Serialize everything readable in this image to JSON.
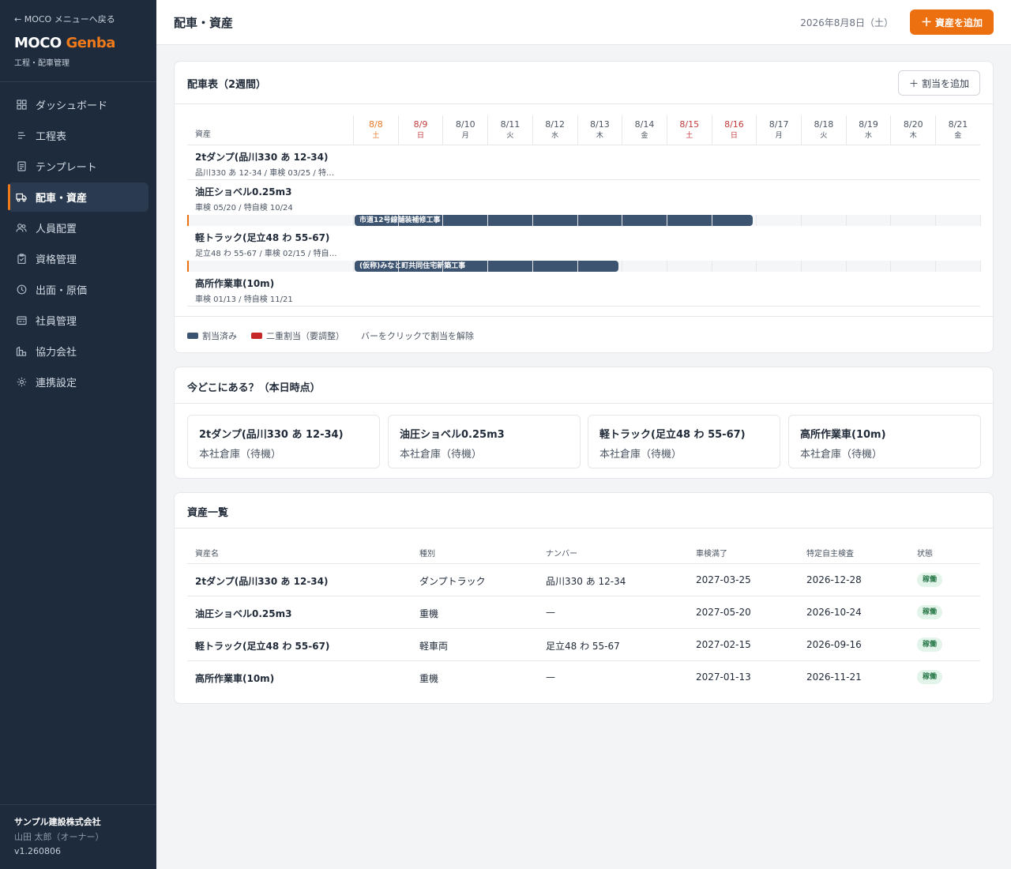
{
  "sidebar": {
    "back_link": "← MOCO メニューへ戻る",
    "brand_main": "MOCO",
    "brand_accent": "Genba",
    "brand_sub": "工程・配車管理",
    "items": [
      {
        "label": "ダッシュボード",
        "icon": "grid-icon"
      },
      {
        "label": "工程表",
        "icon": "list-icon"
      },
      {
        "label": "テンプレート",
        "icon": "document-icon"
      },
      {
        "label": "配車・資産",
        "icon": "truck-icon",
        "active": true
      },
      {
        "label": "人員配置",
        "icon": "users-icon"
      },
      {
        "label": "資格管理",
        "icon": "clipboard-icon"
      },
      {
        "label": "出面・原価",
        "icon": "clock-icon"
      },
      {
        "label": "社員管理",
        "icon": "id-card-icon"
      },
      {
        "label": "協力会社",
        "icon": "building-icon"
      },
      {
        "label": "連携設定",
        "icon": "sun-gear-icon"
      }
    ],
    "company": "サンプル建設株式会社",
    "user": "山田 太郎（オーナー）",
    "version": "v1.260806"
  },
  "header": {
    "title": "配車・資産",
    "date": "2026年8月8日（土）",
    "add_asset_label": "資産を追加"
  },
  "schedule": {
    "title": "配車表（2週間）",
    "add_assignment_label": "割当を追加",
    "asset_header": "資産",
    "days": [
      {
        "date": "8/8",
        "weekday": "土",
        "kind": "sat"
      },
      {
        "date": "8/9",
        "weekday": "日",
        "kind": "hol"
      },
      {
        "date": "8/10",
        "weekday": "月",
        "kind": ""
      },
      {
        "date": "8/11",
        "weekday": "火",
        "kind": ""
      },
      {
        "date": "8/12",
        "weekday": "水",
        "kind": ""
      },
      {
        "date": "8/13",
        "weekday": "木",
        "kind": ""
      },
      {
        "date": "8/14",
        "weekday": "金",
        "kind": ""
      },
      {
        "date": "8/15",
        "weekday": "土",
        "kind": "hol"
      },
      {
        "date": "8/16",
        "weekday": "日",
        "kind": "hol"
      },
      {
        "date": "8/17",
        "weekday": "月",
        "kind": ""
      },
      {
        "date": "8/18",
        "weekday": "火",
        "kind": ""
      },
      {
        "date": "8/19",
        "weekday": "水",
        "kind": ""
      },
      {
        "date": "8/20",
        "weekday": "木",
        "kind": ""
      },
      {
        "date": "8/21",
        "weekday": "金",
        "kind": ""
      }
    ],
    "rows": [
      {
        "name": "2tダンプ(品川330 あ 12-34)",
        "sub": "品川330 あ 12-34 / 車検 03/25 / 特…"
      },
      {
        "name": "油圧ショベル0.25m3",
        "sub": "車検 05/20 / 特自検 10/24"
      },
      {
        "name": "軽トラック(足立48 わ 55-67)",
        "sub": "足立48 わ 55-67 / 車検 02/15 / 特自…"
      },
      {
        "name": "高所作業車(10m)",
        "sub": "車検 01/13 / 特自検 11/21"
      }
    ],
    "assignments": [
      {
        "label": "市道12号線舗装補修工事",
        "start_day": 0,
        "span_days": 9
      },
      {
        "label": "(仮称)みなと町共同住宅新築工事",
        "start_day": 0,
        "span_days": 6
      }
    ],
    "legend": {
      "assigned": "割当済み",
      "double": "二重割当（要調整）",
      "hint": "バーをクリックで割当を解除",
      "assigned_color": "#3d5470",
      "double_color": "#c62828"
    }
  },
  "location": {
    "title": "今どこにある？（本日時点）",
    "items": [
      {
        "name": "2tダンプ(品川330 あ 12-34)",
        "place": "本社倉庫（待機）"
      },
      {
        "name": "油圧ショベル0.25m3",
        "place": "本社倉庫（待機）"
      },
      {
        "name": "軽トラック(足立48 わ 55-67)",
        "place": "本社倉庫（待機）"
      },
      {
        "name": "高所作業車(10m)",
        "place": "本社倉庫（待機）"
      }
    ]
  },
  "assets": {
    "title": "資産一覧",
    "columns": [
      "資産名",
      "種別",
      "ナンバー",
      "車検満了",
      "特定自主検査",
      "状態"
    ],
    "rows": [
      [
        "2tダンプ(品川330 あ 12-34)",
        "ダンプトラック",
        "品川330 あ 12-34",
        "2027-03-25",
        "2026-12-28",
        "稼働"
      ],
      [
        "油圧ショベル0.25m3",
        "重機",
        "—",
        "2027-05-20",
        "2026-10-24",
        "稼働"
      ],
      [
        "軽トラック(足立48 わ 55-67)",
        "軽車両",
        "足立48 わ 55-67",
        "2027-02-15",
        "2026-09-16",
        "稼働"
      ],
      [
        "高所作業車(10m)",
        "重機",
        "—",
        "2027-01-13",
        "2026-11-21",
        "稼働"
      ]
    ]
  },
  "colors": {
    "accent": "#ec6f10",
    "sidebar_bg": "#1d2b3d",
    "bar": "#3d5470",
    "status_bg": "#e3f4ea",
    "status_text": "#2b7a4b"
  }
}
